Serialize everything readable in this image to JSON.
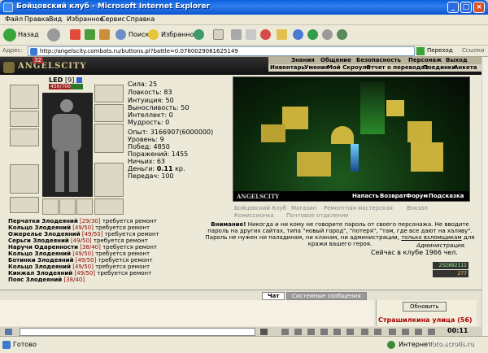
{
  "window": {
    "title": "Бойцовский клуб - Microsoft Internet Explorer"
  },
  "menu": [
    "Файл",
    "Правка",
    "Вид",
    "Избранное",
    "Сервис",
    "Справка"
  ],
  "toolbar": {
    "back": "Назад",
    "search": "Поиск",
    "favorites": "Избранное"
  },
  "address": {
    "label": "Адрес:",
    "url": "http://angelscity.combats.ru/buttons.pl?battle=0.0760029081625149",
    "go": "Переход",
    "links": "Ссылки"
  },
  "site": {
    "logo": "ANGELSCITY",
    "logo_number": "32",
    "nav_top": [
      "Знания",
      "Общение",
      "Безопасность",
      "Персонаж",
      "Выход"
    ],
    "nav_bottom": [
      "Инвентарь",
      "Умения",
      "Мой Скроулл",
      "Отчет о переводах",
      "Поединки",
      "Анкета"
    ]
  },
  "character": {
    "name": "LED",
    "level": "[9]",
    "hp": "450/700"
  },
  "stats": [
    "Сила: 25",
    "Ловкость: 83",
    "Интуиция: 50",
    "Выносливость: 50",
    "Интеллект: 0",
    "Мудрость: 0"
  ],
  "record": [
    "Опыт: 3166907(6000000)",
    "Уровень: 9",
    "Побед: 4850",
    "Поражений: 1455",
    "Ничьих: 63"
  ],
  "money": {
    "label": "Деньги:",
    "value": "0.11",
    "unit": "кр."
  },
  "transfers": "Передач: 100",
  "items": [
    {
      "name": "Перчатки Злодеяний",
      "dur": "[29/30]",
      "note": "требуется ремонт"
    },
    {
      "name": "Кольцо Злодеяний",
      "dur": "[49/50]",
      "note": "требуется ремонт"
    },
    {
      "name": "Ожерелье Злодеяний",
      "dur": "[49/50]",
      "note": "требуется ремонт"
    },
    {
      "name": "Серьги Злодеяний",
      "dur": "[49/50]",
      "note": "требуется ремонт"
    },
    {
      "name": "Наручи Одаренности",
      "dur": "[38/40]",
      "note": "требуется ремонт"
    },
    {
      "name": "Кольцо Злодеяний",
      "dur": "[49/50]",
      "note": "требуется ремонт"
    },
    {
      "name": "Ботинки Злодеяний",
      "dur": "[49/50]",
      "note": "требуется ремонт"
    },
    {
      "name": "Кольцо Злодеяний",
      "dur": "[49/50]",
      "note": "требуется ремонт"
    },
    {
      "name": "Кинжал Злодеяний",
      "dur": "[49/50]",
      "note": "требуется ремонт"
    },
    {
      "name": "Пояс Злодеяний",
      "dur": "[38/40]",
      "note": "требуется ремонт"
    }
  ],
  "city": {
    "brand": "ANGELSCITY",
    "links": [
      "Напасть",
      "Возврат",
      "Форум",
      "Подсказка"
    ]
  },
  "locations": [
    "Бойцовский Клуб",
    "Магазин",
    "Ремонтная мастерская",
    "Вокзал",
    "Комиссионка",
    "Почтовое отделение"
  ],
  "notice": {
    "bold": "Внимание!",
    "text": "Никогда и ни кому не говорите пароль от своего персонажа. Не вводите пароль на других сайтах, типа \"новый город\", \"потеря\", \"там, где все дают на халяву\". Пароль не нужен ни паладинам, ни кланам, ни администрации,",
    "underline": "только взломщикам",
    "tail": "для кражи вашего героя.",
    "sign": "Администрация.",
    "online": "Сейчас в клубе 1966 чел."
  },
  "counter": {
    "top": "252892111",
    "bottom": "277"
  },
  "chat": {
    "tab_chat": "Чат",
    "tab_system": "Системные сообщения",
    "refresh": "Обновить",
    "location": "Страшилкина улица (56)"
  },
  "status": {
    "ready": "Готово",
    "zone": "Интернет"
  },
  "watermark": "foto.scrolls.ru",
  "clock": "00:11"
}
